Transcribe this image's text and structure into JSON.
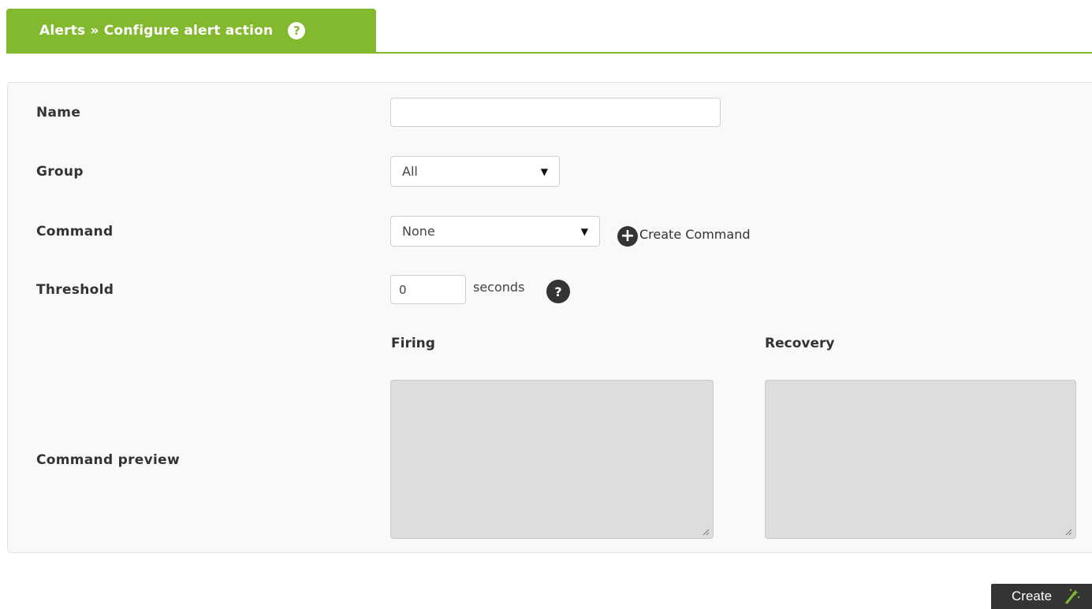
{
  "header": {
    "title": "Alerts » Configure alert action",
    "help_glyph": "?",
    "help_icon": "help-circle-icon"
  },
  "form": {
    "name": {
      "label": "Name",
      "value": ""
    },
    "group": {
      "label": "Group",
      "selected": "All"
    },
    "command": {
      "label": "Command",
      "selected": "None",
      "create_link": "Create Command",
      "create_icon": "plus-circle-icon"
    },
    "threshold": {
      "label": "Threshold",
      "value": "0",
      "unit": "seconds",
      "help_glyph": "?"
    },
    "preview": {
      "label": "Command preview",
      "firing_heading": "Firing",
      "recovery_heading": "Recovery",
      "firing_value": "",
      "recovery_value": ""
    }
  },
  "actions": {
    "create_label": "Create",
    "create_icon": "magic-wand-icon"
  },
  "colors": {
    "accent": "#82b92e",
    "dark_button": "#343434",
    "panel_bg": "#f9f9f9",
    "preview_bg": "#dddddd"
  }
}
